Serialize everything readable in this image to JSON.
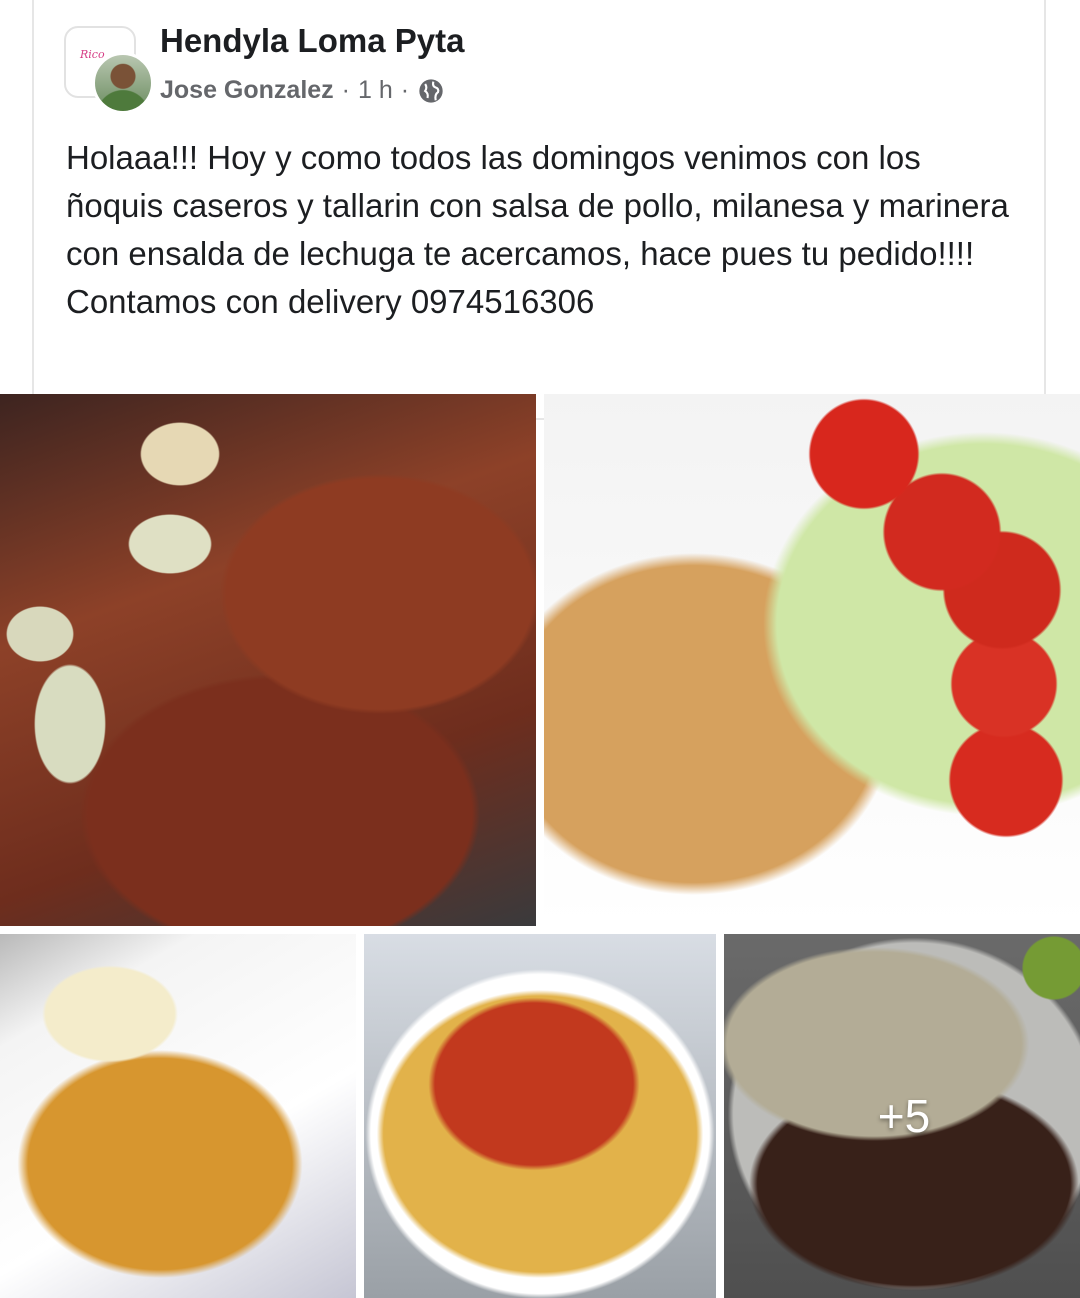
{
  "post": {
    "group_name": "Hendyla Loma Pyta",
    "author": "Jose Gonzalez",
    "separator": "·",
    "time": "1 h",
    "audience_icon": "globe-icon",
    "text": "Holaaa!!! Hoy y como todos las domingos venimos con los ñoquis caseros y tallarin con salsa de pollo, milanesa y marinera con ensalda de lechuga te acercamos, hace pues tu pedido!!!! Contamos con delivery 0974516306"
  },
  "photos": {
    "more_count": "+5"
  }
}
